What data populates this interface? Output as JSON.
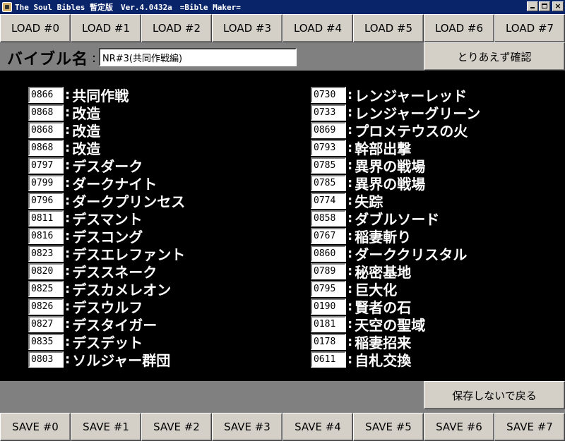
{
  "window": {
    "title": "The Soul Bibles 暫定版　Ver.4.0432a　=Bible Maker=",
    "minimize_icon": "minimize-icon",
    "maximize_icon": "maximize-icon",
    "close_icon": "close-icon"
  },
  "load_buttons": [
    "LOAD #0",
    "LOAD #1",
    "LOAD #2",
    "LOAD #3",
    "LOAD #4",
    "LOAD #5",
    "LOAD #6",
    "LOAD #7"
  ],
  "save_buttons": [
    "SAVE #0",
    "SAVE #1",
    "SAVE #2",
    "SAVE #3",
    "SAVE #4",
    "SAVE #5",
    "SAVE #6",
    "SAVE #7"
  ],
  "bible_name": {
    "label": "バイブル名",
    "colon": ":",
    "value": "NR#3(共同作戦編)"
  },
  "confirm_button": "とりあえず確認",
  "back_button": "保存しないで戻る",
  "cards_left": [
    {
      "code": "0866",
      "name": "共同作戦"
    },
    {
      "code": "0868",
      "name": "改造"
    },
    {
      "code": "0868",
      "name": "改造"
    },
    {
      "code": "0868",
      "name": "改造"
    },
    {
      "code": "0797",
      "name": "デスダーク"
    },
    {
      "code": "0799",
      "name": "ダークナイト"
    },
    {
      "code": "0796",
      "name": "ダークプリンセス"
    },
    {
      "code": "0811",
      "name": "デスマント"
    },
    {
      "code": "0816",
      "name": "デスコング"
    },
    {
      "code": "0823",
      "name": "デスエレファント"
    },
    {
      "code": "0820",
      "name": "デススネーク"
    },
    {
      "code": "0825",
      "name": "デスカメレオン"
    },
    {
      "code": "0826",
      "name": "デスウルフ"
    },
    {
      "code": "0827",
      "name": "デスタイガー"
    },
    {
      "code": "0835",
      "name": "デスデット"
    },
    {
      "code": "0803",
      "name": "ソルジャー群団"
    }
  ],
  "cards_right": [
    {
      "code": "0730",
      "name": "レンジャーレッド"
    },
    {
      "code": "0733",
      "name": "レンジャーグリーン"
    },
    {
      "code": "0869",
      "name": "プロメテウスの火"
    },
    {
      "code": "0793",
      "name": "幹部出撃"
    },
    {
      "code": "0785",
      "name": "異界の戦場"
    },
    {
      "code": "0785",
      "name": "異界の戦場"
    },
    {
      "code": "0774",
      "name": "失踪"
    },
    {
      "code": "0858",
      "name": "ダブルソード"
    },
    {
      "code": "0767",
      "name": "稲妻斬り"
    },
    {
      "code": "0860",
      "name": "ダーククリスタル"
    },
    {
      "code": "0789",
      "name": "秘密基地"
    },
    {
      "code": "0795",
      "name": "巨大化"
    },
    {
      "code": "0190",
      "name": "賢者の石"
    },
    {
      "code": "0181",
      "name": "天空の聖域"
    },
    {
      "code": "0178",
      "name": "稲妻招来"
    },
    {
      "code": "0611",
      "name": "自札交換"
    }
  ],
  "row_colon": ":",
  "colors": {
    "titlebar": "#0a246a",
    "button_face": "#d4d0c8",
    "panel_gray": "#808080",
    "list_background": "#000000",
    "card_text": "#ffffff"
  }
}
